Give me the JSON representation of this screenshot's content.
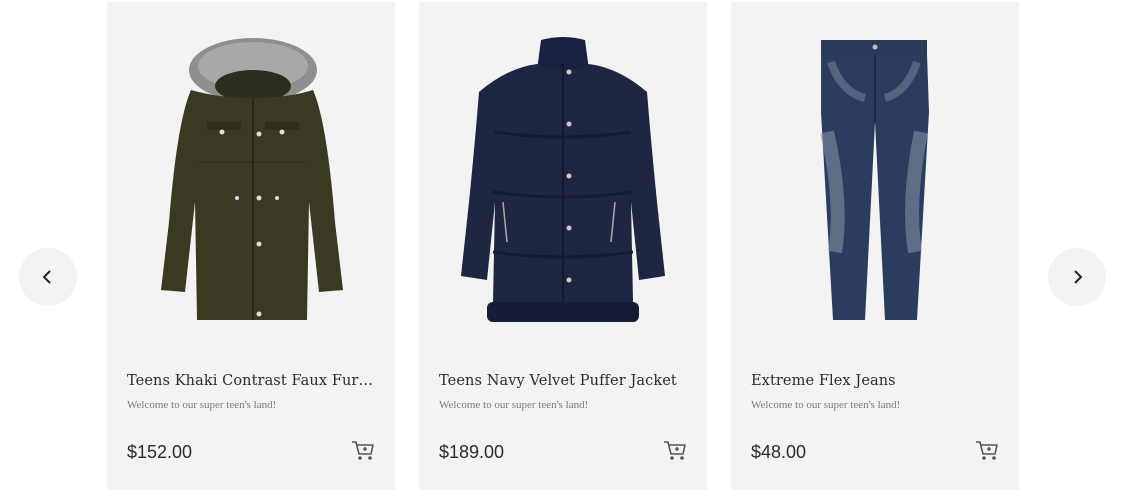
{
  "carousel": {
    "prev_icon": "chevron-left-icon",
    "next_icon": "chevron-right-icon",
    "products": [
      {
        "title": "Teens Khaki Contrast Faux Fur Trim Parka",
        "description": "Welcome to our super teen's land!",
        "price": "$152.00",
        "image_icon": "parka-jacket-image",
        "color": "#3a3a22"
      },
      {
        "title": "Teens Navy Velvet Puffer Jacket",
        "description": "Welcome to our super teen's land!",
        "price": "$189.00",
        "image_icon": "puffer-jacket-image",
        "color": "#1e2642"
      },
      {
        "title": "Extreme Flex Jeans",
        "description": "Welcome to our super teen's land!",
        "price": "$48.00",
        "image_icon": "jeans-image",
        "color": "#2c3c5e"
      }
    ],
    "cart_icon": "cart-icon"
  }
}
